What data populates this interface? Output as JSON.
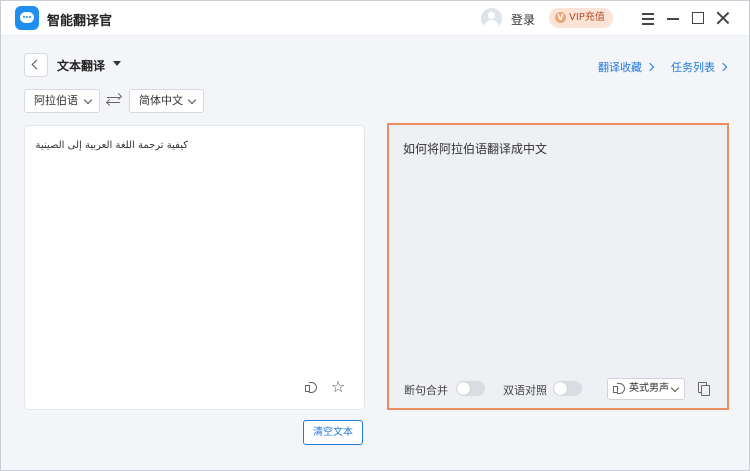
{
  "app": {
    "title": "智能翻译官"
  },
  "header": {
    "login_label": "登录",
    "vip_label": "VIP充值"
  },
  "toolbar": {
    "mode_label": "文本翻译",
    "favorites_link": "翻译收藏",
    "tasks_link": "任务列表"
  },
  "languages": {
    "source": "阿拉伯语",
    "target": "简体中文"
  },
  "source_panel": {
    "text": "كيفية ترجمة اللغة العربية إلى الصينية"
  },
  "target_panel": {
    "text": "如何将阿拉伯语翻译成中文",
    "merge_label": "断句合并",
    "merge_on": false,
    "bilingual_label": "双语对照",
    "bilingual_on": false,
    "voice": "英式男声"
  },
  "actions": {
    "clear_label": "清空文本"
  },
  "colors": {
    "accent": "#1f7ae0",
    "highlight_border": "#ec8d5f",
    "brand": "#1f8ef0"
  }
}
